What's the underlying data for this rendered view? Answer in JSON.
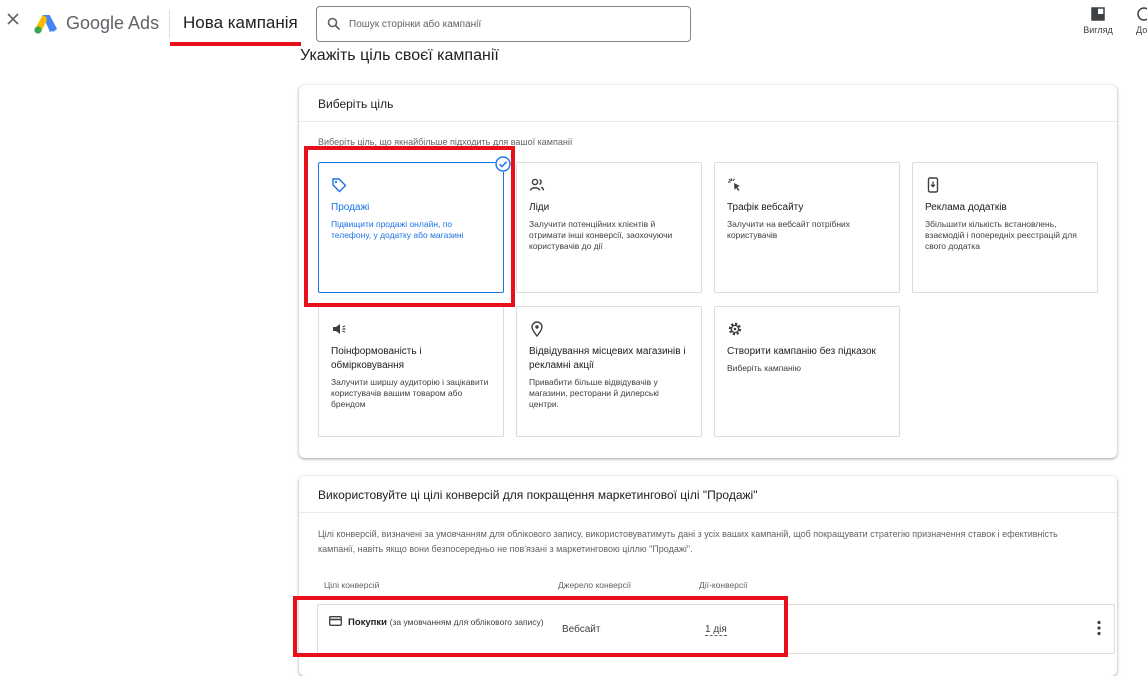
{
  "header": {
    "brand": "Google Ads",
    "tab_title": "Нова кампанія",
    "search_placeholder": "Пошук сторінки або кампанії",
    "tools": [
      {
        "label": "Вигляд",
        "icon": "view-icon"
      },
      {
        "label": "Дов",
        "icon": "help-icon"
      }
    ]
  },
  "page": {
    "heading": "Укажіть ціль своєї кампанії"
  },
  "goal_card": {
    "title": "Виберіть ціль",
    "subtitle": "Виберіть ціль, що якнайбільше підходить для вашої кампанії",
    "goals": [
      {
        "title": "Продажі",
        "desc": "Підвищити продажі онлайн, по телефону, у додатку або магазині",
        "icon": "tag-icon",
        "selected": true
      },
      {
        "title": "Ліди",
        "desc": "Залучити потенційних клієнтів й отримати інші конверсії, заохочуючи користувачів до дії",
        "icon": "people-icon",
        "selected": false
      },
      {
        "title": "Трафік вебсайту",
        "desc": "Залучити на вебсайт потрібних користувачів",
        "icon": "cursor-click-icon",
        "selected": false
      },
      {
        "title": "Реклама додатків",
        "desc": "Збільшити кількість встановлень, взаємодій і попередніх реєстрацій для свого додатка",
        "icon": "phone-download-icon",
        "selected": false
      },
      {
        "title": "Поінформованість і обмірковування",
        "desc": "Залучити ширшу аудиторію і зацікавити користувачів вашим товаром або брендом",
        "icon": "megaphone-icon",
        "selected": false
      },
      {
        "title": "Відвідування місцевих магазинів і рекламні акції",
        "desc": "Привабити більше відвідувачів у магазини, ресторани й дилерські центри.",
        "icon": "location-pin-icon",
        "selected": false
      },
      {
        "title": "Створити кампанію без підказок",
        "desc": "Виберіть кампанію",
        "icon": "gear-icon",
        "selected": false
      }
    ]
  },
  "conversion_card": {
    "title": "Використовуйте ці цілі конверсій для покращення маркетингової цілі \"Продажі\"",
    "desc": "Цілі конверсій, визначені за умовчанням для облікового запису, використовуватимуть дані з усіх ваших кампаній, щоб покращувати стратегію призначення ставок і ефективність кампанії, навіть якщо вони безпосередньо не пов'язані з маркетинговою ціллю \"Продажі\".",
    "columns": [
      "Цілі конверсій",
      "Джерело конверсії",
      "Дії-конверсії"
    ],
    "rows": [
      {
        "name": "Покупки",
        "note": "(за умовчанням для облікового запису)",
        "source": "Вебсайт",
        "actions": "1 дія"
      }
    ]
  },
  "colors": {
    "accent": "#1a73e8",
    "highlight": "#e8101a"
  }
}
